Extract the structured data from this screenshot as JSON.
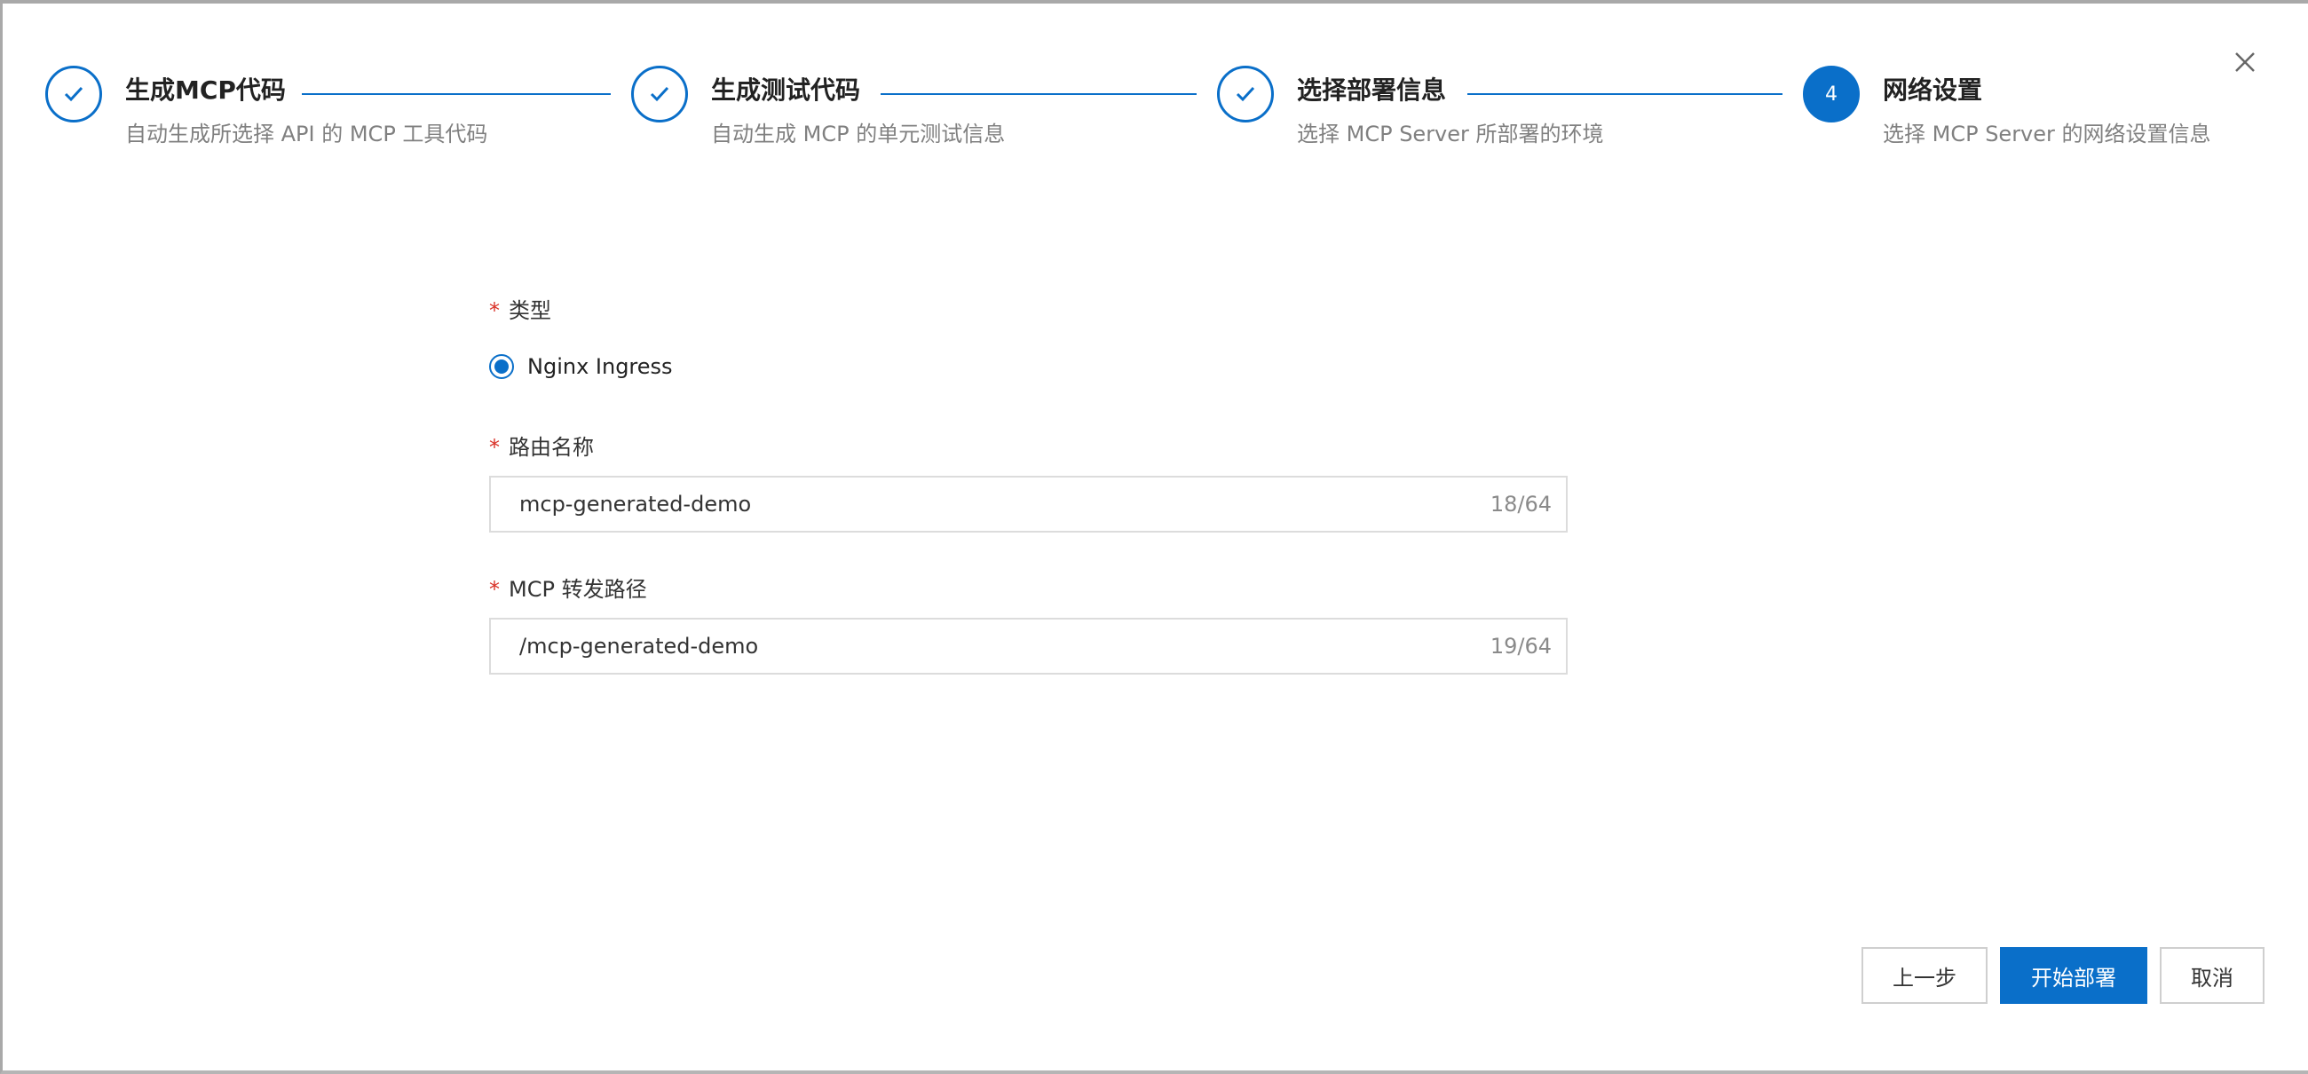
{
  "dialog": {
    "close_icon": "close-icon"
  },
  "steps": [
    {
      "title": "生成MCP代码",
      "description": "自动生成所选择 API 的 MCP 工具代码",
      "status": "done",
      "icon": "check-icon"
    },
    {
      "title": "生成测试代码",
      "description": "自动生成 MCP 的单元测试信息",
      "status": "done",
      "icon": "check-icon"
    },
    {
      "title": "选择部署信息",
      "description": "选择 MCP Server 所部署的环境",
      "status": "done",
      "icon": "check-icon"
    },
    {
      "title": "网络设置",
      "description": "选择 MCP Server 的网络设置信息",
      "status": "active",
      "number": "4"
    }
  ],
  "form": {
    "required_mark": "*",
    "type": {
      "label": "类型",
      "option": "Nginx Ingress",
      "selected": true
    },
    "route_name": {
      "label": "路由名称",
      "value": "mcp-generated-demo",
      "counter": "18/64"
    },
    "forward_path": {
      "label": "MCP 转发路径",
      "value": "/mcp-generated-demo",
      "counter": "19/64"
    }
  },
  "footer": {
    "prev_label": "上一步",
    "deploy_label": "开始部署",
    "cancel_label": "取消"
  },
  "colors": {
    "accent": "#0a6fc9",
    "required": "#d93026",
    "border": "#dcdcdc"
  }
}
